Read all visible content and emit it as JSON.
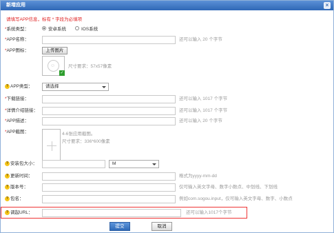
{
  "dialog": {
    "title": "新增应用",
    "close_glyph": "×"
  },
  "notice": "请填写APP信息，标有 * 字段为必填项",
  "system_type": {
    "required_mark": "*",
    "label": "系统类型：",
    "options": [
      "安卓系统",
      "IOS系统"
    ],
    "selected": "安卓系统"
  },
  "app_name": {
    "required_mark": "*",
    "label": "APP名称：",
    "hint": "还可以输入 20 个字节"
  },
  "app_icon": {
    "required_mark": "*",
    "label": "APP图标：",
    "upload_label": "上传图片",
    "size_hint": "尺寸要求：57x57像素",
    "icon_name": "placeholder-face-icon"
  },
  "app_type": {
    "label": "APP类型：",
    "selected": "请选择"
  },
  "download_link": {
    "required_mark": "*",
    "label": "下载链接：",
    "hint": "还可以输入 1017 个字节"
  },
  "detail_link": {
    "required_mark": "*",
    "label": "详情介绍链接：",
    "hint": "还可以输入 1017 个字节"
  },
  "app_desc": {
    "required_mark": "*",
    "label": "APP描述：",
    "hint": "还可以输入 20 个字节"
  },
  "screenshots": {
    "required_mark": "*",
    "label": "APP截图：",
    "hint_count": "4-6张应用截图。",
    "hint_size": "尺寸要求：336*600像素"
  },
  "package_size": {
    "label": "安装包大小：",
    "unit": "M"
  },
  "update_time": {
    "label": "更新时间：",
    "hint": "格式为yyyy-mm-dd"
  },
  "version": {
    "label": "版本号：",
    "hint": "仅可输入英文字母、数字小数点、中划线、下划线"
  },
  "package_name": {
    "label": "包名：",
    "hint": "例如com.sogou.input，仅可输入英文字母、数字、小数点"
  },
  "invoke_url": {
    "label": "调起URL：",
    "hint": "还可以输入1017个字节"
  },
  "actions": {
    "submit": "提交",
    "cancel": "取消"
  },
  "colors": {
    "title_bar": "#2f68b6",
    "required": "#e02020",
    "highlight_border": "#e33333",
    "help_icon": "#f5c518"
  }
}
